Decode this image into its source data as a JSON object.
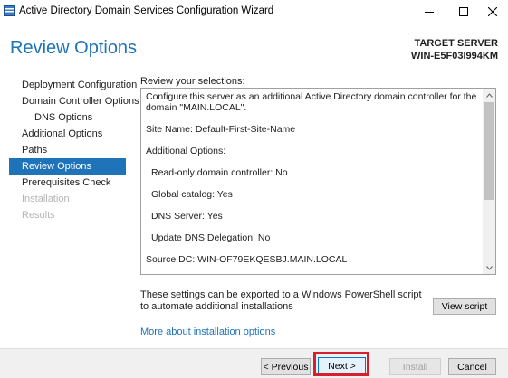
{
  "window": {
    "title": "Active Directory Domain Services Configuration Wizard",
    "controls": [
      "minimize-icon",
      "maximize-icon",
      "close-icon"
    ]
  },
  "header": {
    "heading": "Review Options",
    "target_label": "TARGET SERVER",
    "target_server": "WIN-E5F03I994KM"
  },
  "nav": {
    "items": [
      {
        "label": "Deployment Configuration",
        "state": "normal"
      },
      {
        "label": "Domain Controller Options",
        "state": "normal"
      },
      {
        "label": "DNS Options",
        "state": "normal"
      },
      {
        "label": "Additional Options",
        "state": "normal"
      },
      {
        "label": "Paths",
        "state": "normal"
      },
      {
        "label": "Review Options",
        "state": "active"
      },
      {
        "label": "Prerequisites Check",
        "state": "normal"
      },
      {
        "label": "Installation",
        "state": "disabled"
      },
      {
        "label": "Results",
        "state": "disabled"
      }
    ]
  },
  "review": {
    "label": "Review your selections:",
    "lines": [
      "Configure this server as an additional Active Directory domain controller for the domain \"MAIN.LOCAL\".",
      "Site Name: Default-First-Site-Name",
      "Additional Options:",
      "Read-only domain controller: No",
      "Global catalog: Yes",
      "DNS Server: Yes",
      "Update DNS Delegation: No",
      "Source DC: WIN-OF79EKQESBJ.MAIN.LOCAL"
    ]
  },
  "export": {
    "text": "These settings can be exported to a Windows PowerShell script to automate additional installations",
    "button": "View script"
  },
  "links": {
    "more": "More about installation options"
  },
  "footer": {
    "previous": "< Previous",
    "next": "Next >",
    "install": "Install",
    "cancel": "Cancel"
  },
  "colors": {
    "accent": "#1e73b9",
    "highlight_box": "#d6202b"
  }
}
